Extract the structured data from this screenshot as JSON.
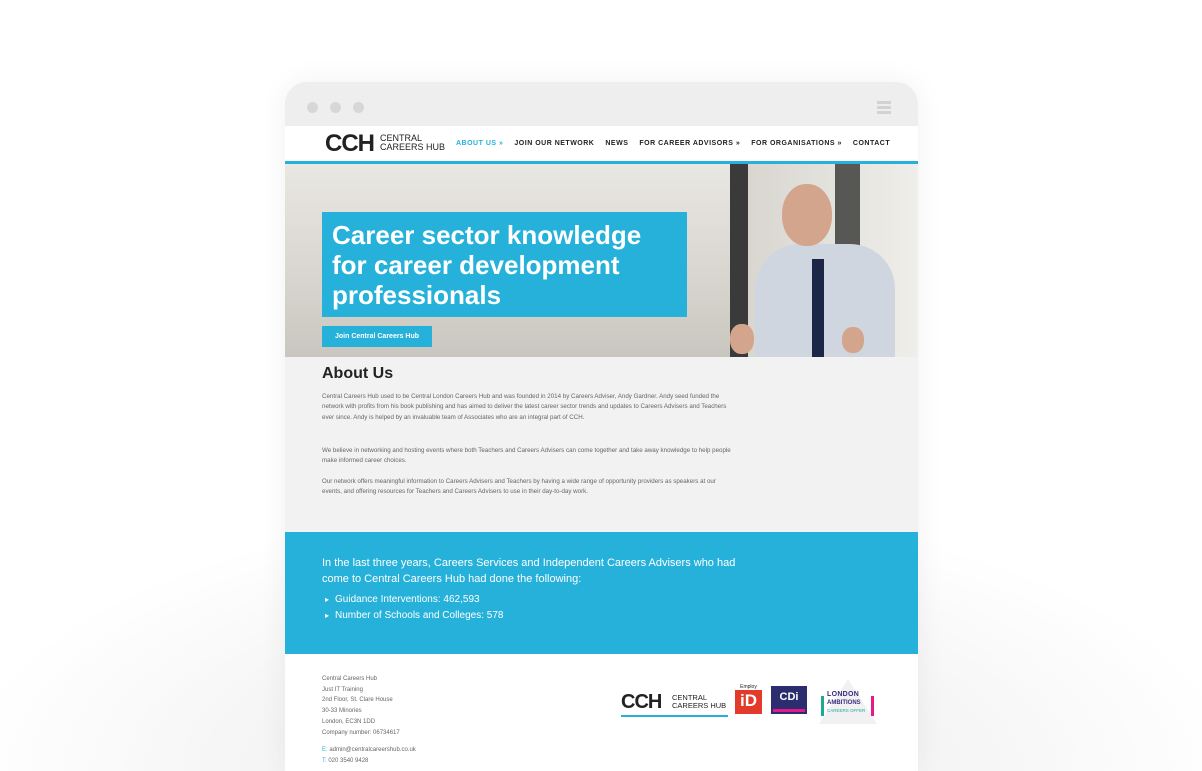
{
  "brand": {
    "logo_mark": "CCH",
    "logo_line1": "CENTRAL",
    "logo_line2": "CAREERS HUB"
  },
  "nav": {
    "items": [
      {
        "label": "ABOUT US »",
        "active": true
      },
      {
        "label": "JOIN OUR NETWORK"
      },
      {
        "label": "NEWS"
      },
      {
        "label": "FOR CAREER ADVISORS »"
      },
      {
        "label": "FOR ORGANISATIONS »"
      },
      {
        "label": "CONTACT"
      }
    ]
  },
  "hero": {
    "title": "Career sector knowledge for career development professionals",
    "button": "Join Central Careers Hub"
  },
  "about": {
    "heading": "About Us",
    "p1": "Central Careers Hub used to be Central London Careers Hub and was founded in 2014 by Careers Adviser, Andy Gardner. Andy seed funded the network with profits from his book publishing and has aimed to deliver the latest career sector trends and updates to Careers Advisers and Teachers ever since. Andy is helped by an invaluable team of Associates who are an integral part of CCH.",
    "p2": "We believe in networking and hosting events where both Teachers and Careers Advisers can come together and take away knowledge to help people make informed career choices.",
    "p3": "Our network offers meaningful information to Careers Advisers and Teachers by having a wide range of opportunity providers as speakers at our events, and offering resources for Teachers and Careers Advisers to use in their day-to-day work."
  },
  "stats": {
    "intro": "In the last three years, Careers Services and Independent Careers Advisers who had come to Central Careers Hub had done the following:",
    "items": [
      "Guidance Interventions: 462,593",
      "Number of Schools and Colleges: 578"
    ]
  },
  "footer": {
    "address": [
      "Central Careers Hub",
      "Just IT Training",
      "2nd Floor, St. Clare House",
      "30-33 Minories",
      "London, EC3N 1DD",
      "Company number: 06734617"
    ],
    "email_label": "E:",
    "email": "admin@centralcareershub.co.uk",
    "phone_label": "T:",
    "phone": "020 3540 9428",
    "partner_logos": {
      "cch_mark": "CCH",
      "cch_line1": "CENTRAL",
      "cch_line2": "CAREERS HUB",
      "employ_top": "Employ",
      "employ_main": "iD",
      "cdi": "CDi",
      "london_line1": "LONDON",
      "london_line2": "AMBITIONS",
      "london_line3": "CAREERS OFFER"
    }
  },
  "colors": {
    "accent": "#26b1da",
    "text_dark": "#222222",
    "text_body": "#666666",
    "section_bg": "#f2f2f2"
  }
}
